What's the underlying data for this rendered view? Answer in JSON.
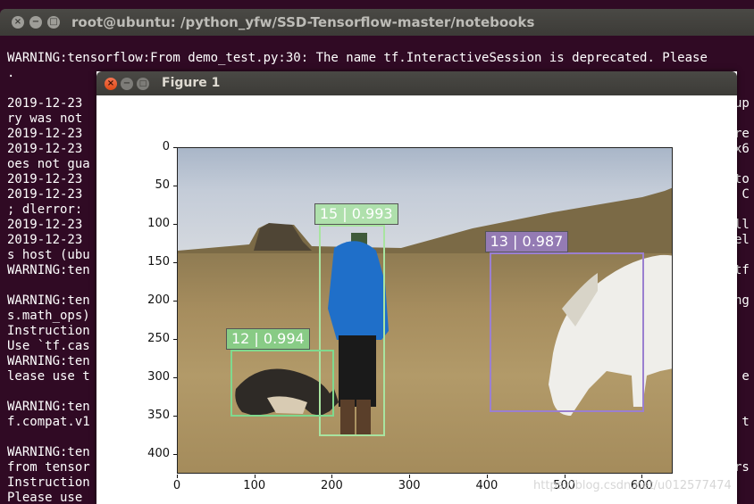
{
  "terminal": {
    "title": "root@ubuntu: /python_yfw/SSD-Tensorflow-master/notebooks",
    "lines": [
      "WARNING:tensorflow:From demo_test.py:30: The name tf.InteractiveSession is deprecated. Please",
      ".",
      "",
      "2019-12-23",
      "ry was not",
      "2019-12-23",
      "2019-12-23",
      "oes not gua",
      "2019-12-23",
      "2019-12-23",
      "; dlerror:",
      "2019-12-23",
      "2019-12-23",
      "s host (ubu",
      "WARNING:ten",
      "",
      "WARNING:ten",
      "s.math_ops)",
      "Instruction",
      "Use `tf.cas",
      "WARNING:ten",
      "lease use t",
      "",
      "WARNING:ten",
      "f.compat.v1",
      "",
      "WARNING:ten",
      "from tensor",
      "Instruction",
      "Please use"
    ],
    "right_lines": [
      "up",
      "",
      "re",
      "x6",
      "",
      "to",
      " C",
      "",
      "ll",
      "el",
      "",
      "tf",
      "",
      "ng",
      "",
      "",
      " ",
      "",
      " e",
      "",
      "",
      " t",
      "",
      "",
      "rs",
      "",
      "",
      ""
    ]
  },
  "figure": {
    "title": "Figure 1",
    "close_glyph": "×",
    "min_glyph": "−",
    "max_glyph": "□"
  },
  "chart_data": {
    "type": "image-detections",
    "y_ticks": [
      "0",
      "50",
      "100",
      "150",
      "200",
      "250",
      "300",
      "350",
      "400"
    ],
    "x_ticks": [
      "0",
      "100",
      "200",
      "300",
      "400",
      "500",
      "600"
    ],
    "xlim": [
      0,
      640
    ],
    "ylim": [
      425,
      0
    ],
    "detections": [
      {
        "label": "15 | 0.993",
        "x0": 182,
        "y0": 100,
        "x1": 268,
        "y1": 375,
        "color": "#a8e4a0"
      },
      {
        "label": "12 | 0.994",
        "x0": 68,
        "y0": 262,
        "x1": 202,
        "y1": 350,
        "color": "#7fd98e"
      },
      {
        "label": "13 | 0.987",
        "x0": 402,
        "y0": 136,
        "x1": 602,
        "y1": 344,
        "color": "#9b7fd0"
      }
    ]
  },
  "watermark": "https://blog.csdn.net/u012577474"
}
